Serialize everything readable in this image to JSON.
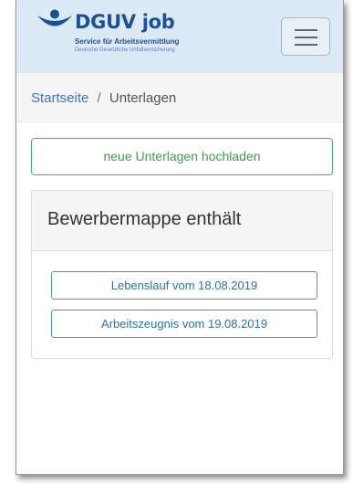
{
  "header": {
    "logo_title": "DGUV job",
    "logo_tagline": "Service für Arbeitsvermittlung",
    "logo_subtitle": "Deutsche Gesetzliche Unfallversicherung",
    "brand_color": "#1a4f9c",
    "menu_icon": "hamburger-icon"
  },
  "breadcrumb": {
    "home": "Startseite",
    "separator": "/",
    "current": "Unterlagen"
  },
  "upload_button": {
    "label": "neue Unterlagen hochladen",
    "color": "#49b05a"
  },
  "panel": {
    "title": "Bewerbermappe enthält",
    "documents": [
      {
        "label": "Lebenslauf vom 18.08.2019"
      },
      {
        "label": "Arbeitszeugnis vom 19.08.2019"
      }
    ],
    "button_color": "#4a8fd0"
  }
}
